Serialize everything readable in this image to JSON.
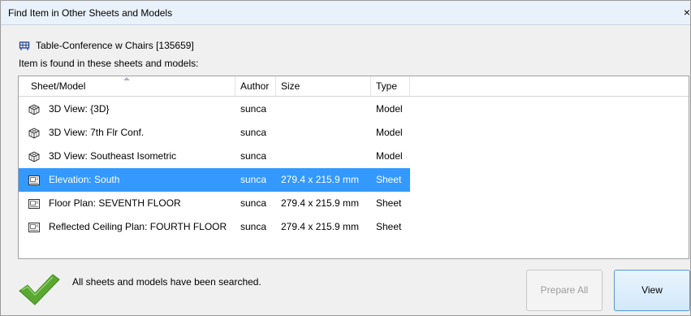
{
  "window": {
    "title": "Find Item in Other Sheets and Models",
    "close_glyph": "×"
  },
  "item": {
    "name": "Table-Conference w Chairs [135659]",
    "icon": "furniture-table-icon"
  },
  "found_label": "Item is found in these sheets and models:",
  "columns": [
    "Sheet/Model",
    "Author",
    "Size",
    "Type"
  ],
  "rows": [
    {
      "name": "3D View: {3D}",
      "author": "sunca",
      "size": "",
      "type": "Model",
      "icon": "3d-view-icon",
      "selected": false
    },
    {
      "name": "3D View: 7th Flr Conf.",
      "author": "sunca",
      "size": "",
      "type": "Model",
      "icon": "3d-view-icon",
      "selected": false
    },
    {
      "name": "3D View: Southeast Isometric",
      "author": "sunca",
      "size": "",
      "type": "Model",
      "icon": "3d-view-icon",
      "selected": false
    },
    {
      "name": "Elevation: South",
      "author": "sunca",
      "size": "279.4 x 215.9 mm",
      "type": "Sheet",
      "icon": "sheet-icon",
      "selected": true
    },
    {
      "name": "Floor Plan: SEVENTH FLOOR",
      "author": "sunca",
      "size": "279.4 x 215.9 mm",
      "type": "Sheet",
      "icon": "sheet-icon",
      "selected": false
    },
    {
      "name": "Reflected Ceiling Plan: FOURTH FLOOR",
      "author": "sunca",
      "size": "279.4 x 215.9 mm",
      "type": "Sheet",
      "icon": "sheet-icon",
      "selected": false
    }
  ],
  "status": {
    "text": "All sheets and models have been searched.",
    "icon": "checkmark-icon",
    "color": "#5aa832"
  },
  "buttons": {
    "prepare_all": "Prepare All",
    "view": "View"
  },
  "colors": {
    "selection": "#3399ff",
    "title_bar": "#e9f1fa"
  }
}
